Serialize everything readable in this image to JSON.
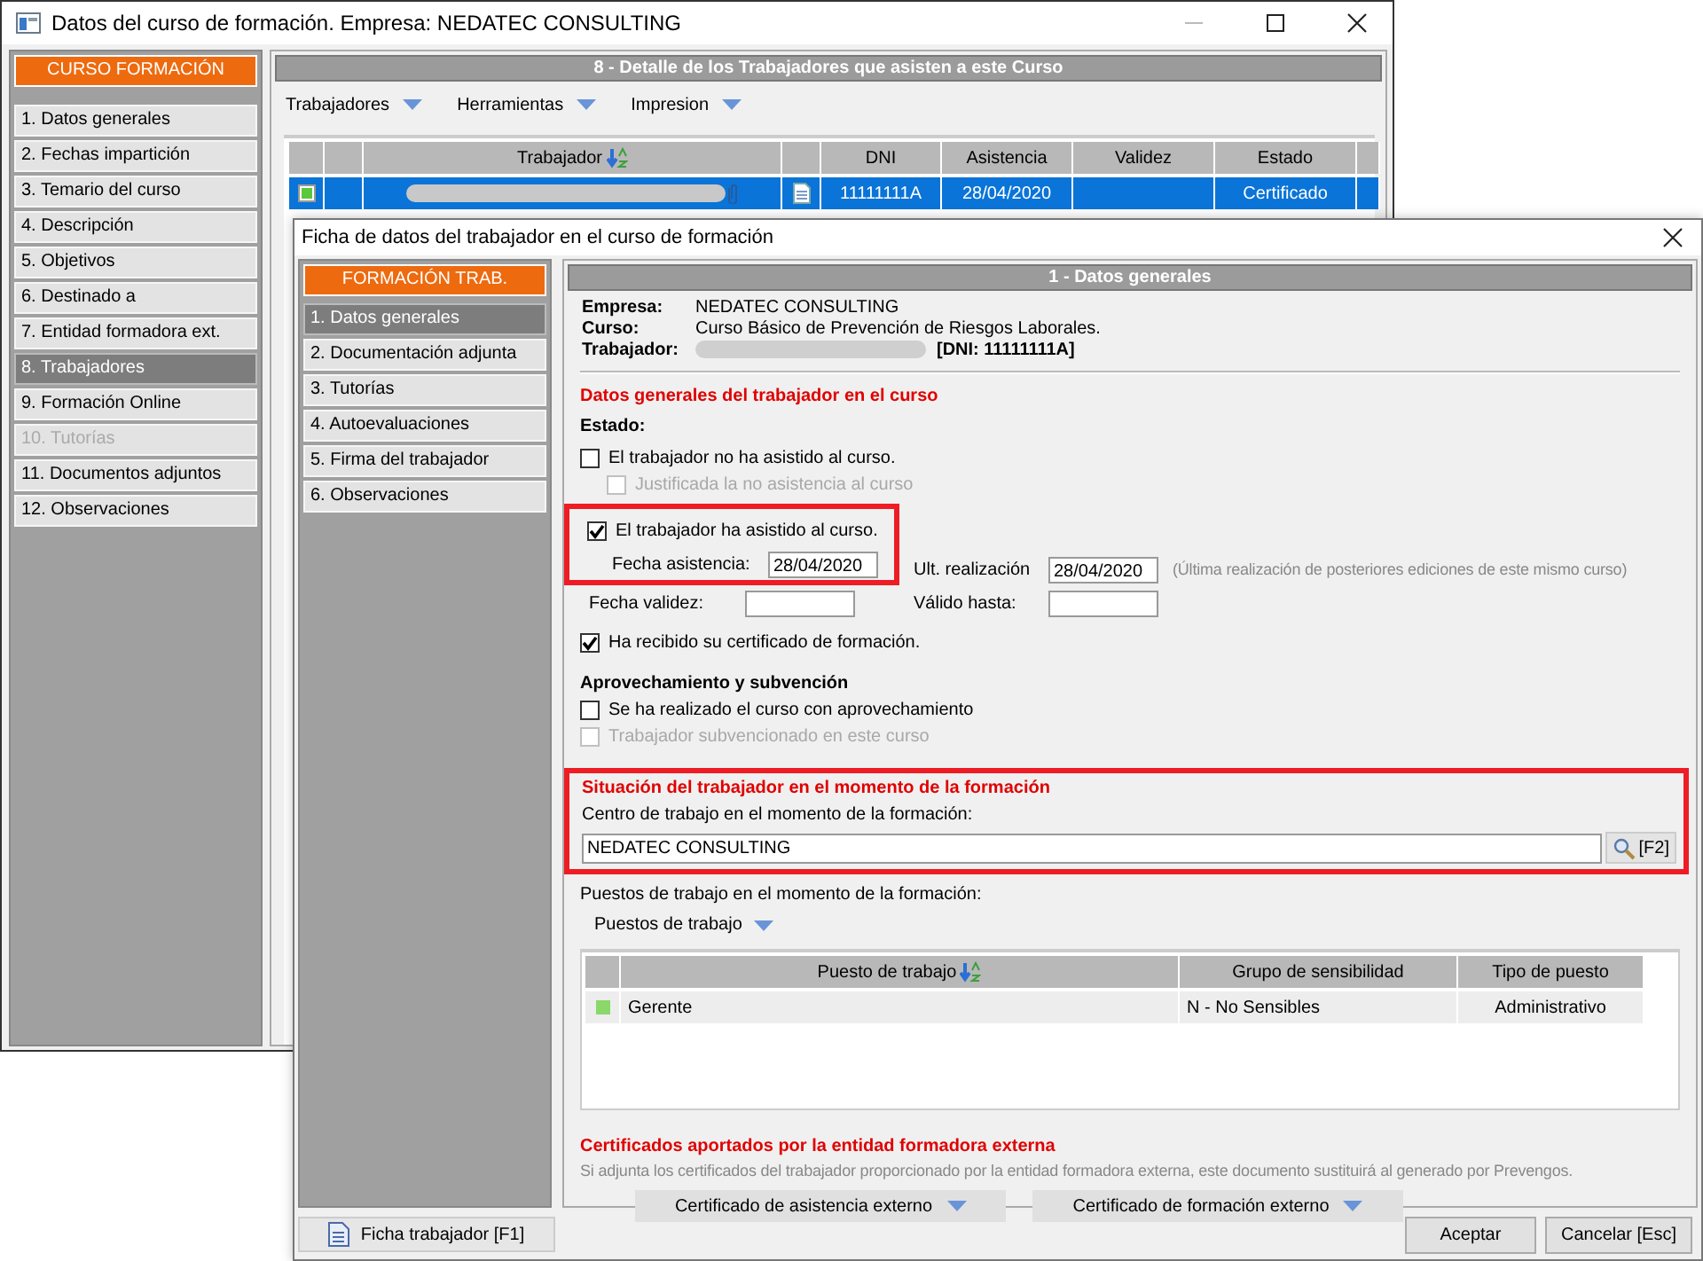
{
  "back_window": {
    "title": "Datos del curso de formación. Empresa: NEDATEC CONSULTING",
    "sidebar": {
      "header": "CURSO FORMACIÓN",
      "items": [
        {
          "label": "1. Datos generales",
          "selected": false,
          "disabled": false
        },
        {
          "label": "2. Fechas impartición",
          "selected": false,
          "disabled": false
        },
        {
          "label": "3. Temario del curso",
          "selected": false,
          "disabled": false
        },
        {
          "label": "4. Descripción",
          "selected": false,
          "disabled": false
        },
        {
          "label": "5. Objetivos",
          "selected": false,
          "disabled": false
        },
        {
          "label": "6. Destinado a",
          "selected": false,
          "disabled": false
        },
        {
          "label": "7. Entidad formadora ext.",
          "selected": false,
          "disabled": false
        },
        {
          "label": "8. Trabajadores",
          "selected": true,
          "disabled": false
        },
        {
          "label": "9. Formación Online",
          "selected": false,
          "disabled": false
        },
        {
          "label": "10. Tutorías",
          "selected": false,
          "disabled": true
        },
        {
          "label": "11. Documentos adjuntos",
          "selected": false,
          "disabled": false
        },
        {
          "label": "12. Observaciones",
          "selected": false,
          "disabled": false
        }
      ]
    },
    "panel_title": "8 - Detalle de los Trabajadores que asisten a este Curso",
    "menus": [
      "Trabajadores",
      "Herramientas",
      "Impresion"
    ],
    "table": {
      "columns": [
        "Trabajador",
        "DNI",
        "Asistencia",
        "Validez",
        "Estado"
      ],
      "rows": [
        {
          "selected": true,
          "dni": "11111111A",
          "asistencia": "28/04/2020",
          "estado": "Certificado"
        }
      ]
    }
  },
  "front_window": {
    "title": "Ficha de datos del trabajador en el curso de formación",
    "sidebar": {
      "header": "FORMACIÓN TRAB.",
      "items": [
        {
          "label": "1. Datos generales",
          "selected": true
        },
        {
          "label": "2. Documentación adjunta",
          "selected": false
        },
        {
          "label": "3. Tutorías",
          "selected": false
        },
        {
          "label": "4. Autoevaluaciones",
          "selected": false
        },
        {
          "label": "5. Firma del trabajador",
          "selected": false
        },
        {
          "label": "6. Observaciones",
          "selected": false
        }
      ]
    },
    "panel_title": "1 - Datos generales",
    "info": [
      {
        "label": "Empresa:",
        "value": "NEDATEC CONSULTING"
      },
      {
        "label": "Curso:",
        "value": "Curso Básico de Prevención de Riesgos Laborales."
      },
      {
        "label": "Trabajador:",
        "value": "[DNI: 11111111A]"
      }
    ],
    "general_heading": "Datos generales del trabajador en el curso",
    "estado_label": "Estado:",
    "not_attended": {
      "label": "El trabajador no ha asistido al curso.",
      "checked": false,
      "disabled": false,
      "children": [
        {
          "label": "Justificada la no asistencia al curso",
          "checked": false,
          "disabled": true
        }
      ]
    },
    "attended": {
      "highlighted": true,
      "label": "El trabajador ha asistido al curso.",
      "checked": true,
      "disabled": false,
      "fecha_asistencia": {
        "label": "Fecha asistencia:",
        "value": "28/04/2020"
      }
    },
    "ult_realizacion": {
      "label": "Ult. realización",
      "value": "28/04/2020",
      "note": "(Última realización de posteriores ediciones de este mismo curso)"
    },
    "fecha_validez": {
      "label": "Fecha validez:"
    },
    "valido_hasta": {
      "label": "Válido hasta:"
    },
    "certificate_received": {
      "label": "Ha recibido su certificado de formación.",
      "checked": true,
      "disabled": false
    },
    "aprovechamiento_heading": "Aprovechamiento y subvención",
    "aprovechamiento_checks": [
      {
        "label": "Se ha realizado el curso con aprovechamiento",
        "checked": false,
        "disabled": false
      },
      {
        "label": "Trabajador subvencionado en este curso",
        "checked": false,
        "disabled": true
      }
    ],
    "situacion": {
      "highlighted": true,
      "heading": "Situación del trabajador en el momento de la formación",
      "field_label": "Centro de trabajo en el momento de la formación:",
      "value": "NEDATEC CONSULTING",
      "button": "[F2]"
    },
    "puestos_label": "Puestos de trabajo en el momento de la formación:",
    "puestos_menu": "Puestos de trabajo",
    "puestos_table": {
      "columns": [
        "Puesto de trabajo",
        "Grupo de sensibilidad",
        "Tipo de puesto"
      ],
      "rows": [
        {
          "puesto": "Gerente",
          "grupo": "N - No Sensibles",
          "tipo": "Administrativo"
        }
      ]
    },
    "cert_heading": "Certificados aportados por la entidad formadora externa",
    "cert_note": "Si adjunta los certificados del trabajador proporcionado por la entidad formadora externa, este documento sustituirá al generado por Prevengos.",
    "cert_buttons": [
      "Certificado de asistencia externo",
      "Certificado de formación externo"
    ],
    "footer_left": "Ficha trabajador  [F1]",
    "footer_buttons": [
      "Aceptar",
      "Cancelar  [Esc]"
    ]
  }
}
